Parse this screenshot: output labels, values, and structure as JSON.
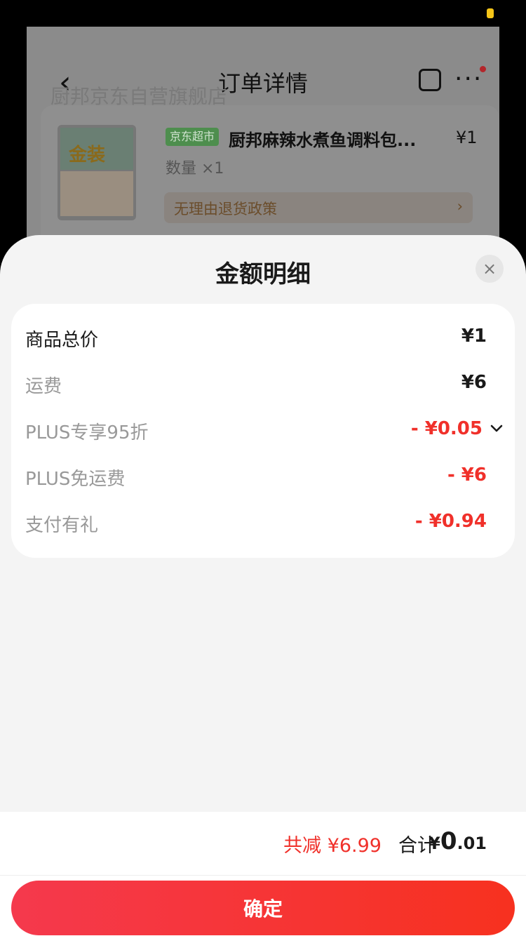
{
  "background_page": {
    "title": "订单详情",
    "shop_name": "厨邦京东自营旗舰店",
    "product": {
      "tag": "京东超市",
      "name": "厨邦麻辣水煮鱼调料包...",
      "price": "¥1",
      "quantity": "数量 ×1",
      "image_text": "金装",
      "policy": "无理由退货政策",
      "policy_arrow": "›"
    },
    "icons": {
      "back": "chevron-left-icon",
      "share": "share-icon",
      "more": "more-icon"
    }
  },
  "sheet": {
    "title": "金额明细",
    "close_label": "×",
    "rows": [
      {
        "label": "商品总价",
        "value": "¥1",
        "label_style": "strong",
        "value_color": "#1a1a1a"
      },
      {
        "label": "运费",
        "value": "¥6",
        "label_style": "muted",
        "value_color": "#1a1a1a"
      },
      {
        "label": "PLUS专享95折",
        "value": "- ¥0.05",
        "label_style": "muted",
        "value_color": "#f0302a",
        "expandable": true
      },
      {
        "label": "PLUS免运费",
        "value": "- ¥6",
        "label_style": "muted",
        "value_color": "#f0302a"
      },
      {
        "label": "支付有礼",
        "value": "- ¥0.94",
        "label_style": "muted",
        "value_color": "#f0302a"
      }
    ]
  },
  "footer": {
    "saved": "共减 ¥6.99",
    "total_label": "合计",
    "total_currency": "¥",
    "total_integer": "0",
    "total_decimal": ".01",
    "confirm_label": "确定"
  },
  "colors": {
    "accent_red": "#f0302a",
    "button_gradient_start": "#f5394d",
    "button_gradient_end": "#f7311f",
    "status_yellow": "#f5c518"
  }
}
